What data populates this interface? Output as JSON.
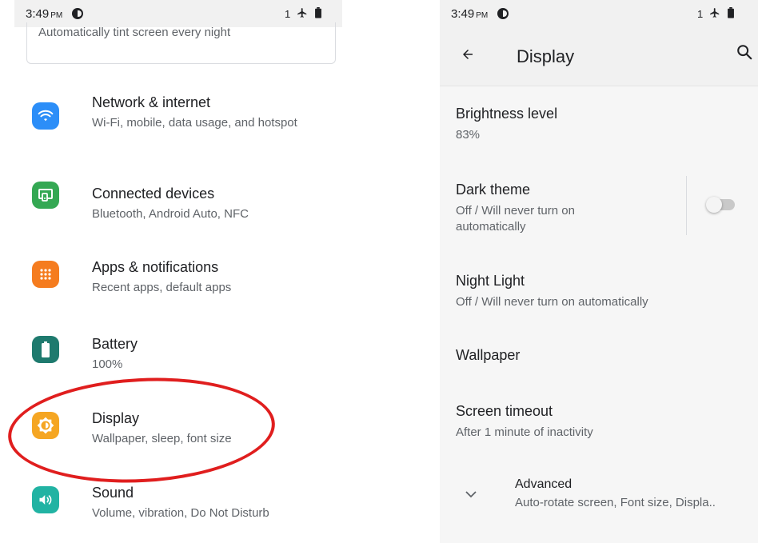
{
  "left": {
    "status_bar": {
      "time": "3:49",
      "ampm": "PM",
      "sim": "1"
    },
    "suggestion": {
      "text": "Automatically tint screen every night"
    },
    "items": [
      {
        "title": "Network & internet",
        "subtitle": "Wi-Fi, mobile, data usage, and hotspot",
        "icon": "wifi-icon",
        "color": "#2c8ef8"
      },
      {
        "title": "Connected devices",
        "subtitle": "Bluetooth, Android Auto, NFC",
        "icon": "connected-devices-icon",
        "color": "#34a853"
      },
      {
        "title": "Apps & notifications",
        "subtitle": "Recent apps, default apps",
        "icon": "apps-grid-icon",
        "color": "#f57c1f"
      },
      {
        "title": "Battery",
        "subtitle": "100%",
        "icon": "battery-icon",
        "color": "#1e7a6e"
      },
      {
        "title": "Display",
        "subtitle": "Wallpaper, sleep, font size",
        "icon": "brightness-icon",
        "color": "#f5a623"
      },
      {
        "title": "Sound",
        "subtitle": "Volume, vibration, Do Not Disturb",
        "icon": "volume-icon",
        "color": "#21b3a3"
      }
    ]
  },
  "right": {
    "status_bar": {
      "time": "3:49",
      "ampm": "PM",
      "sim": "1"
    },
    "app_bar": {
      "title": "Display"
    },
    "prefs": {
      "brightness": {
        "title": "Brightness level",
        "summary": "83%"
      },
      "dark_theme": {
        "title": "Dark theme",
        "summary": "Off / Will never turn on automatically",
        "enabled": false
      },
      "night_light": {
        "title": "Night Light",
        "summary": "Off / Will never turn on automatically"
      },
      "wallpaper": {
        "title": "Wallpaper"
      },
      "screen_timeout": {
        "title": "Screen timeout",
        "summary": "After 1 minute of inactivity"
      },
      "advanced": {
        "title": "Advanced",
        "summary": "Auto-rotate screen, Font size, Displa.."
      }
    }
  },
  "colors": {
    "highlight": "#e01e1e",
    "toggle_off_track": "#c9c9c9"
  }
}
